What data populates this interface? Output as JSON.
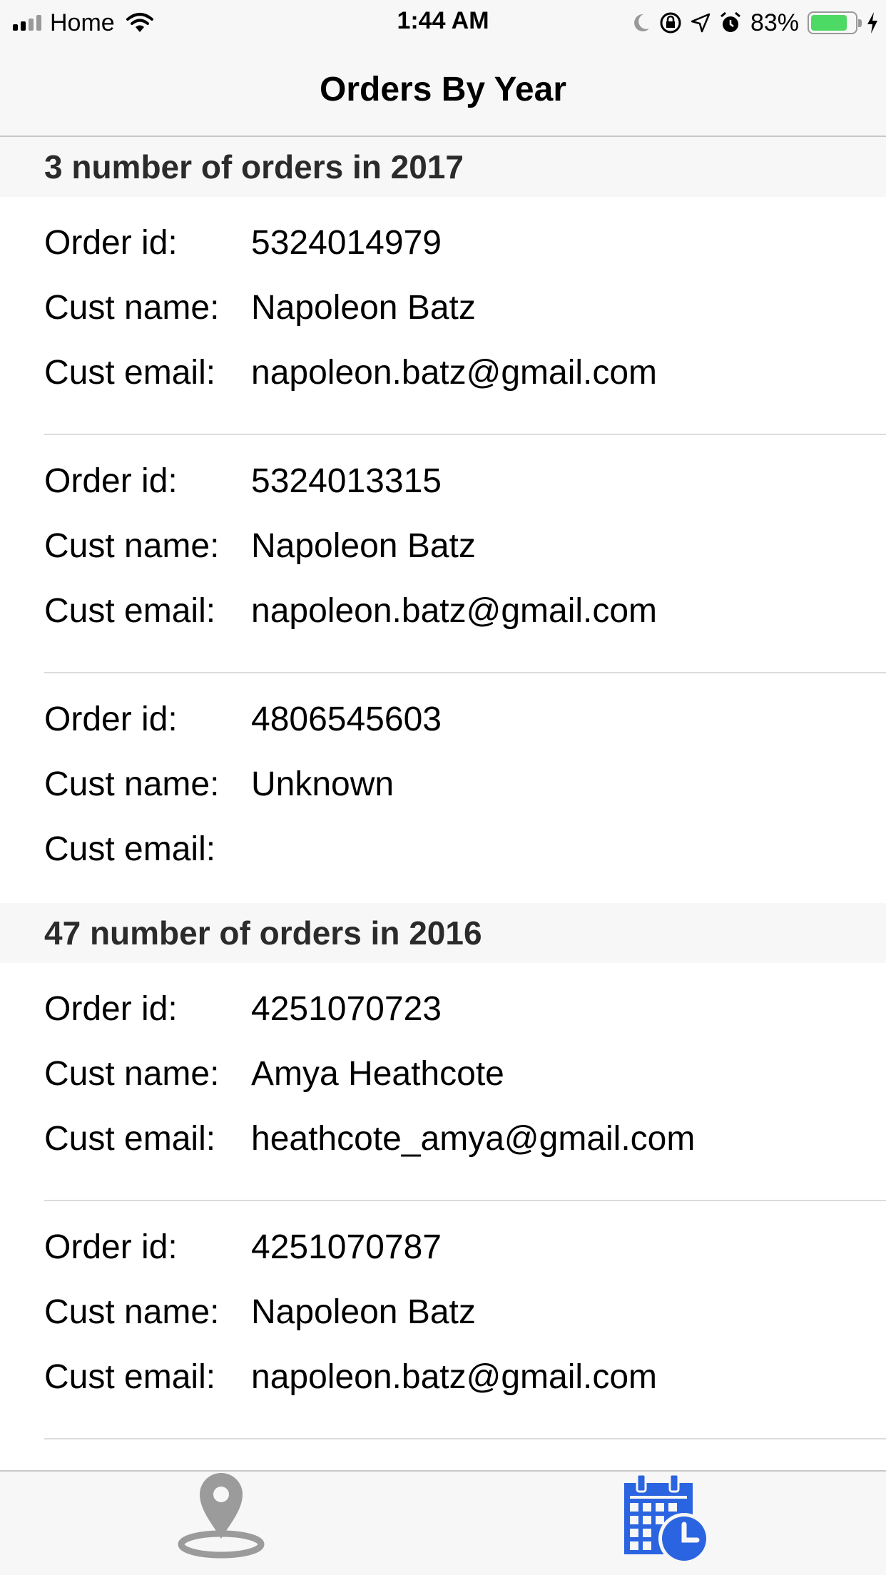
{
  "status_bar": {
    "carrier": "Home",
    "time": "1:44 AM",
    "battery_percent": "83%",
    "battery_level": 0.83,
    "battery_color": "#4cd964",
    "icons": [
      "signal-icon",
      "wifi-icon",
      "moon-icon",
      "rotation-lock-icon",
      "location-icon",
      "alarm-icon",
      "battery-icon",
      "charging-icon"
    ]
  },
  "nav": {
    "title": "Orders By Year"
  },
  "labels": {
    "order_id": "Order id:",
    "cust_name": "Cust name:",
    "cust_email": "Cust email:"
  },
  "sections": [
    {
      "title": "3 number of orders in 2017",
      "orders": [
        {
          "order_id": "5324014979",
          "cust_name": "Napoleon Batz",
          "cust_email": "napoleon.batz@gmail.com"
        },
        {
          "order_id": "5324013315",
          "cust_name": "Napoleon Batz",
          "cust_email": "napoleon.batz@gmail.com"
        },
        {
          "order_id": "4806545603",
          "cust_name": "Unknown",
          "cust_email": ""
        }
      ]
    },
    {
      "title": "47 number of orders in 2016",
      "orders": [
        {
          "order_id": "4251070723",
          "cust_name": "Amya Heathcote",
          "cust_email": "heathcote_amya@gmail.com"
        },
        {
          "order_id": "4251070787",
          "cust_name": "Napoleon Batz",
          "cust_email": "napoleon.batz@gmail.com"
        }
      ]
    }
  ],
  "tab_bar": {
    "tabs": [
      {
        "icon": "map-pin-icon",
        "selected": false
      },
      {
        "icon": "calendar-clock-icon",
        "selected": true
      }
    ],
    "inactive_color": "#9b9b9b",
    "active_color": "#2b64e0"
  }
}
